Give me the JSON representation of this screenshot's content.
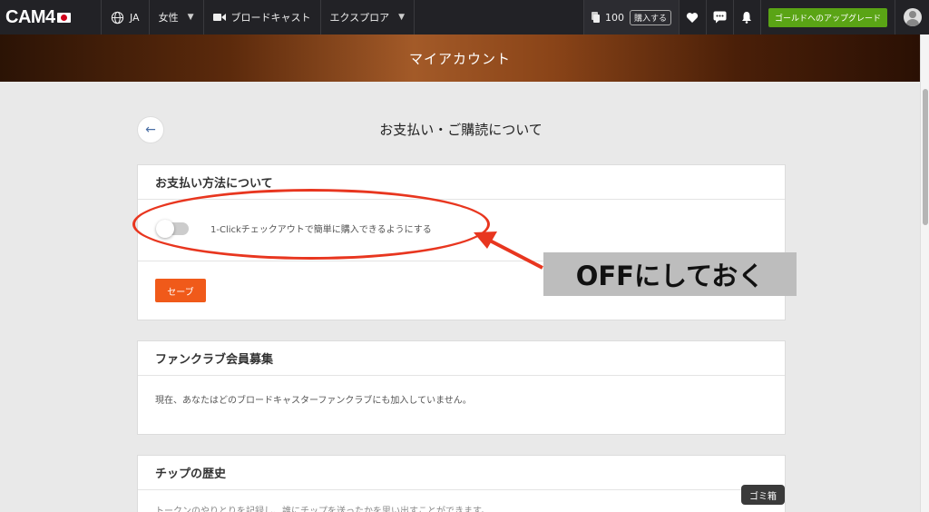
{
  "topnav": {
    "logo": "CAM4",
    "language": "JA",
    "gender": "女性",
    "broadcast": "ブロードキャスト",
    "explore": "エクスプロア",
    "tokens": "100",
    "buy": "購入する",
    "upgrade": "ゴールドへのアップグレード"
  },
  "banner": {
    "title": "マイアカウント"
  },
  "page": {
    "title": "お支払い・ご購読について"
  },
  "payment": {
    "header": "お支払い方法について",
    "toggle_label": "1-Clickチェックアウトで簡単に購入できるようにする",
    "toggle_on": false,
    "save": "セーブ"
  },
  "fanclub": {
    "header": "ファンクラブ会員募集",
    "text": "現在、あなたはどのブロードキャスターファンクラブにも加入していません。"
  },
  "tips": {
    "header": "チップの歴史",
    "text": "トークンのやりとりを記録し、誰にチップを送ったかを思い出すことができます。"
  },
  "annotation": {
    "callout": "OFFにしておく"
  },
  "tooltip": "ゴミ箱",
  "colors": {
    "accent": "#f05a1a",
    "annotation": "#e8361f",
    "upgrade": "#5aa415"
  }
}
